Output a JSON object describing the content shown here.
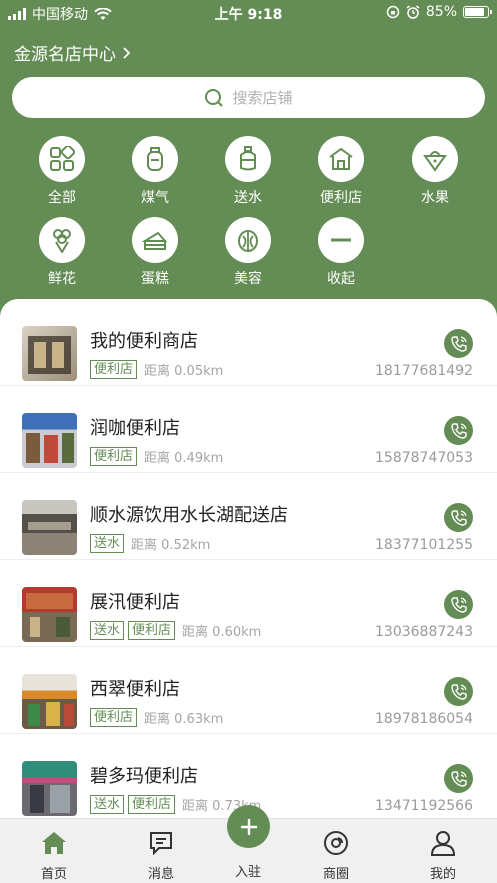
{
  "status_bar": {
    "carrier": "中国移动",
    "time": "上午 9:18",
    "battery": "85%",
    "battery_level": 0.85
  },
  "location": {
    "label": "金源名店中心"
  },
  "search": {
    "placeholder": "搜索店铺"
  },
  "categories": [
    {
      "label": "全部",
      "icon": "grid-icon"
    },
    {
      "label": "煤气",
      "icon": "gas-tank-icon"
    },
    {
      "label": "送水",
      "icon": "water-bottle-icon"
    },
    {
      "label": "便利店",
      "icon": "store-icon"
    },
    {
      "label": "水果",
      "icon": "fruit-icon"
    },
    {
      "label": "鲜花",
      "icon": "flower-icon"
    },
    {
      "label": "蛋糕",
      "icon": "cake-icon"
    },
    {
      "label": "美容",
      "icon": "beauty-icon"
    },
    {
      "label": "收起",
      "icon": "collapse-icon"
    }
  ],
  "stores": [
    {
      "name": "我的便利商店",
      "tags": [
        "便利店"
      ],
      "distance": "距离 0.05km",
      "phone": "18177681492"
    },
    {
      "name": "润咖便利店",
      "tags": [
        "便利店"
      ],
      "distance": "距离 0.49km",
      "phone": "15878747053"
    },
    {
      "name": "顺水源饮用水长湖配送店",
      "tags": [
        "送水"
      ],
      "distance": "距离 0.52km",
      "phone": "18377101255"
    },
    {
      "name": "展汛便利店",
      "tags": [
        "送水",
        "便利店"
      ],
      "distance": "距离 0.60km",
      "phone": "13036887243"
    },
    {
      "name": "西翠便利店",
      "tags": [
        "便利店"
      ],
      "distance": "距离 0.63km",
      "phone": "18978186054"
    },
    {
      "name": "碧多玛便利店",
      "tags": [
        "送水",
        "便利店"
      ],
      "distance": "距离 0.73km",
      "phone": "13471192566"
    }
  ],
  "tabbar": {
    "home": "首页",
    "messages": "消息",
    "join": "入驻",
    "circle": "商圈",
    "mine": "我的"
  },
  "colors": {
    "primary": "#648d55",
    "tag": "#648d55"
  }
}
